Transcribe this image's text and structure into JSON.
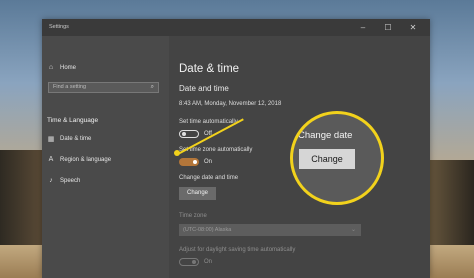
{
  "window": {
    "title": "Settings",
    "controls": [
      "–",
      "☐",
      "✕"
    ]
  },
  "sidebar": {
    "home": "Home",
    "search_placeholder": "Find a setting",
    "section": "Time & Language",
    "items": [
      {
        "label": "Date & time",
        "icon": "date-time-icon"
      },
      {
        "label": "Region & language",
        "icon": "language-icon"
      },
      {
        "label": "Speech",
        "icon": "microphone-icon"
      }
    ]
  },
  "main": {
    "title": "Date & time",
    "subtitle": "Date and time",
    "current_datetime": "8:43 AM, Monday, November 12, 2018",
    "set_time_auto": {
      "label": "Set time automatically",
      "state": "Off"
    },
    "set_tz_auto": {
      "label": "Set time zone automatically",
      "state": "On"
    },
    "change_dt": {
      "label": "Change date and time",
      "button": "Change"
    },
    "time_zone": {
      "label": "Time zone",
      "value": "(UTC-08:00) Alaska"
    },
    "dst": {
      "label": "Adjust for daylight saving time automatically",
      "state": "On"
    }
  },
  "callout": {
    "title": "Change date",
    "button": "Change",
    "color": "#f2d21c"
  }
}
